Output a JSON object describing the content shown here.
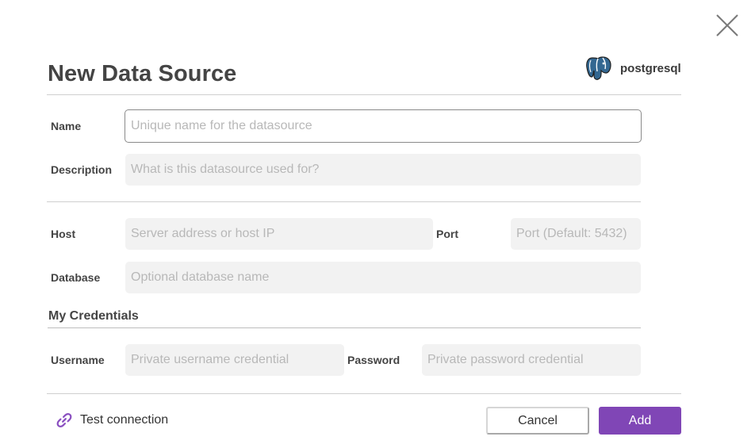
{
  "dialog": {
    "title": "New Data Source",
    "datasource_type": "postgresql",
    "close_icon": "close-icon"
  },
  "fields": {
    "name": {
      "label": "Name",
      "value": "",
      "placeholder": "Unique name for the datasource"
    },
    "description": {
      "label": "Description",
      "value": "",
      "placeholder": "What is this datasource used for?"
    },
    "host": {
      "label": "Host",
      "value": "",
      "placeholder": "Server address or host IP"
    },
    "port": {
      "label": "Port",
      "value": "",
      "placeholder": "Port (Default: 5432)"
    },
    "database": {
      "label": "Database",
      "value": "",
      "placeholder": "Optional database name"
    }
  },
  "credentials": {
    "title": "My Credentials",
    "username": {
      "label": "Username",
      "value": "",
      "placeholder": "Private username credential"
    },
    "password": {
      "label": "Password",
      "value": "",
      "placeholder": "Private password credential"
    }
  },
  "footer": {
    "test_connection_label": "Test connection",
    "test_connection_icon": "link-icon",
    "cancel_label": "Cancel",
    "add_label": "Add"
  },
  "colors": {
    "accent": "#8046b6",
    "link_icon": "#8a4fc0",
    "postgres_blue": "#336791"
  }
}
